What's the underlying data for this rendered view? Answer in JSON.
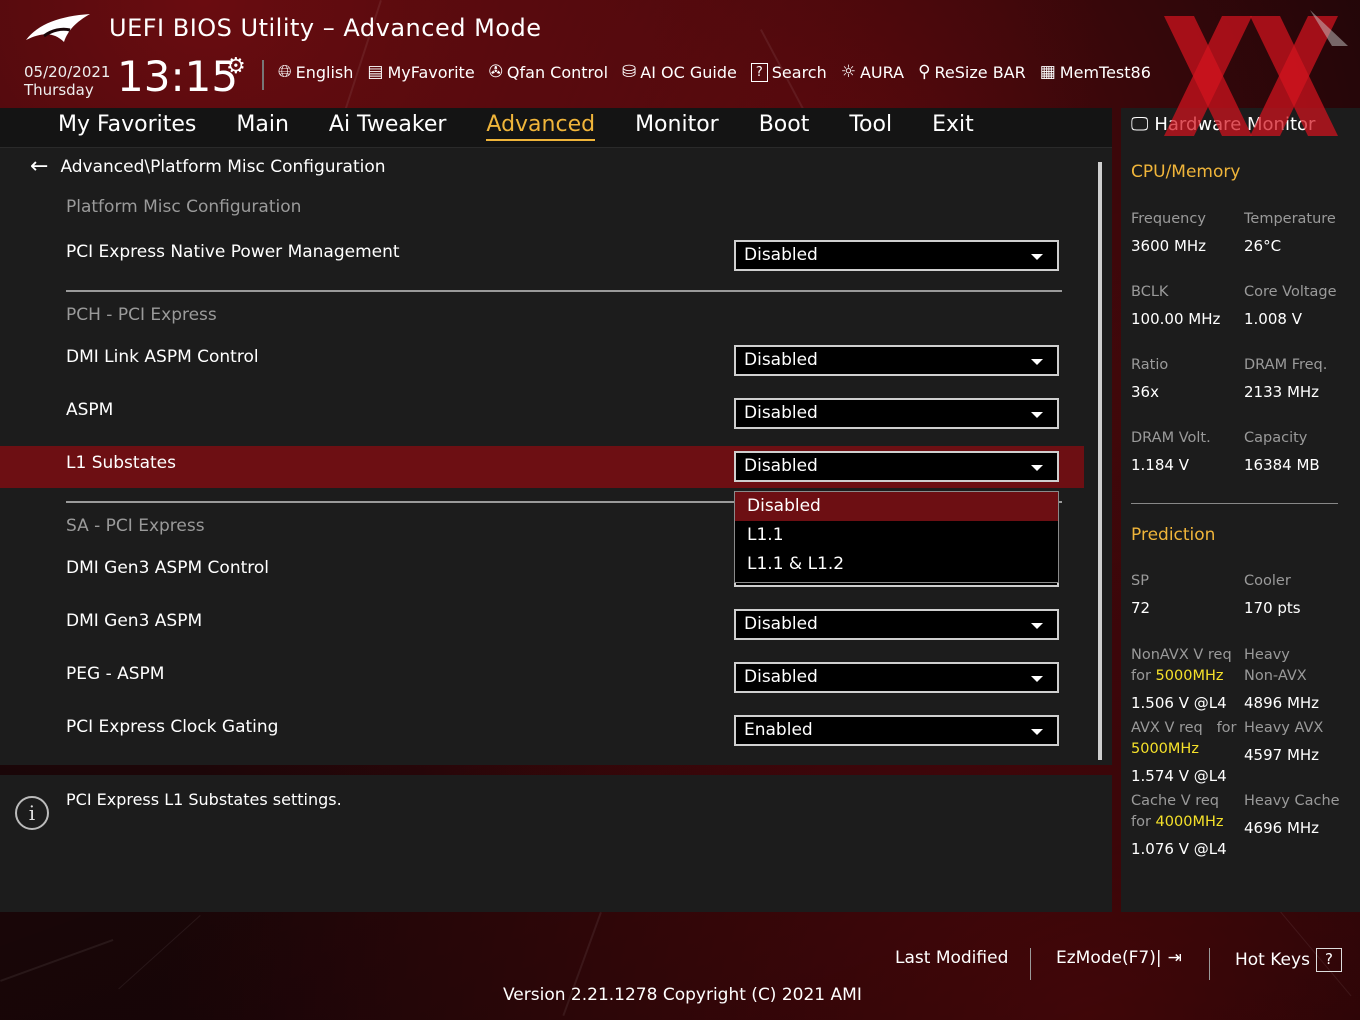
{
  "header": {
    "title": "UEFI BIOS Utility – Advanced Mode",
    "date": "05/20/2021",
    "weekday": "Thursday",
    "time": "13:15",
    "toolbar": [
      {
        "label": "English",
        "icon": "globe-icon"
      },
      {
        "label": "MyFavorite",
        "icon": "favorite-list-icon"
      },
      {
        "label": "Qfan Control",
        "icon": "fan-icon"
      },
      {
        "label": "AI OC Guide",
        "icon": "ai-guide-icon"
      },
      {
        "label": "Search",
        "icon": "search-help-icon"
      },
      {
        "label": "AURA",
        "icon": "aura-light-icon"
      },
      {
        "label": "ReSize BAR",
        "icon": "resize-bar-icon"
      },
      {
        "label": "MemTest86",
        "icon": "memory-icon"
      }
    ]
  },
  "tabs": [
    "My Favorites",
    "Main",
    "Ai Tweaker",
    "Advanced",
    "Monitor",
    "Boot",
    "Tool",
    "Exit"
  ],
  "active_tab": "Advanced",
  "breadcrumb": "Advanced\\Platform Misc Configuration",
  "sections": {
    "platform": "Platform Misc Configuration",
    "pch": "PCH - PCI Express",
    "sa": "SA - PCI Express"
  },
  "settings": [
    {
      "label": "PCI Express Native Power Management",
      "value": "Disabled"
    },
    {
      "label": "DMI Link ASPM Control",
      "value": "Disabled"
    },
    {
      "label": "ASPM",
      "value": "Disabled"
    },
    {
      "label": "L1 Substates",
      "value": "Disabled"
    },
    {
      "label": "DMI Gen3 ASPM Control",
      "value": ""
    },
    {
      "label": "DMI Gen3 ASPM",
      "value": "Disabled"
    },
    {
      "label": "PEG - ASPM",
      "value": "Disabled"
    },
    {
      "label": "PCI Express Clock Gating",
      "value": "Enabled"
    }
  ],
  "dropdown_menu": {
    "options": [
      "Disabled",
      "L1.1",
      "L1.1 & L1.2"
    ],
    "selected": "Disabled"
  },
  "help_text": "PCI Express L1 Substates settings.",
  "hardware_monitor": {
    "title": "Hardware Monitor",
    "cpu_memory": {
      "heading": "CPU/Memory",
      "frequency_label": "Frequency",
      "frequency": "3600 MHz",
      "temperature_label": "Temperature",
      "temperature": "26°C",
      "bclk_label": "BCLK",
      "bclk": "100.00 MHz",
      "core_voltage_label": "Core Voltage",
      "core_voltage": "1.008 V",
      "ratio_label": "Ratio",
      "ratio": "36x",
      "dram_freq_label": "DRAM Freq.",
      "dram_freq": "2133 MHz",
      "dram_volt_label": "DRAM Volt.",
      "dram_volt": "1.184 V",
      "capacity_label": "Capacity",
      "capacity": "16384 MB"
    },
    "prediction": {
      "heading": "Prediction",
      "sp_label": "SP",
      "sp": "72",
      "cooler_label": "Cooler",
      "cooler": "170 pts",
      "nonavx_label_1": "NonAVX V req",
      "nonavx_for": "for",
      "nonavx_freq": "5000MHz",
      "nonavx_value": "1.506 V @L4",
      "heavy_nonavx_label_1": "Heavy",
      "heavy_nonavx_label_2": "Non-AVX",
      "heavy_nonavx_value": "4896 MHz",
      "avx_label": "AVX V req",
      "avx_for": "for",
      "avx_freq": "5000MHz",
      "avx_value": "1.574 V @L4",
      "heavy_avx_label": "Heavy AVX",
      "heavy_avx_value": "4597 MHz",
      "cache_label": "Cache V req",
      "cache_for": "for",
      "cache_freq": "4000MHz",
      "cache_value": "1.076 V @L4",
      "heavy_cache_label": "Heavy Cache",
      "heavy_cache_value": "4696 MHz"
    }
  },
  "footer": {
    "last_modified": "Last Modified",
    "ezmode": "EzMode(F7)|",
    "hot_keys": "Hot Keys",
    "hot_keys_icon": "?",
    "version": "Version 2.21.1278 Copyright (C) 2021 AMI"
  },
  "colors": {
    "accent": "#f0b53a",
    "highlight_row": "#6d0f13",
    "panel": "#1c1c1c",
    "prediction_freq": "#f5e12a"
  }
}
